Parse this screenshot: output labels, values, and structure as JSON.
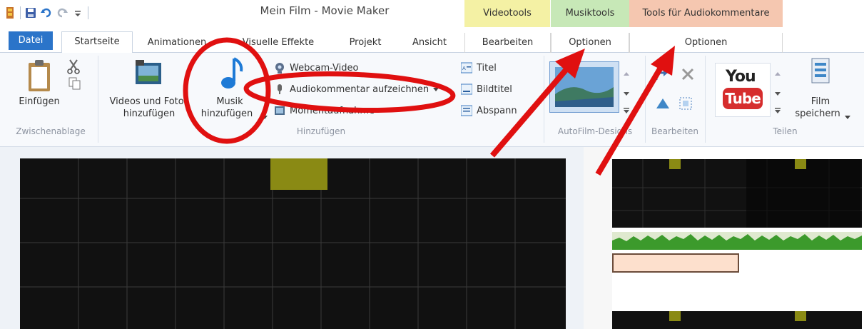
{
  "window": {
    "title": "Mein Film - Movie Maker"
  },
  "contextual_tabs": {
    "video": "Videotools",
    "musik": "Musiktools",
    "audio": "Tools für Audiokommentare"
  },
  "tabs": [
    {
      "label": "Datei"
    },
    {
      "label": "Startseite"
    },
    {
      "label": "Animationen"
    },
    {
      "label": "Visuelle Effekte"
    },
    {
      "label": "Projekt"
    },
    {
      "label": "Ansicht"
    },
    {
      "label": "Bearbeiten"
    },
    {
      "label": "Optionen"
    },
    {
      "label": "Optionen"
    }
  ],
  "ribbon": {
    "clipboard": {
      "paste_label": "Einfügen",
      "group_label": "Zwischenablage"
    },
    "add": {
      "videos_line1": "Videos und Fotos",
      "videos_line2": "hinzufügen",
      "music_line1": "Musik",
      "music_line2": "hinzufügen",
      "webcam": "Webcam-Video",
      "narration": "Audiokommentar aufzeichnen",
      "snapshot": "Momentaufnahme",
      "title": "Titel",
      "caption": "Bildtitel",
      "credits": "Abspann",
      "group_label": "Hinzufügen"
    },
    "themes": {
      "group_label": "AutoFilm-Designs"
    },
    "edit": {
      "group_label": "Bearbeiten"
    },
    "share": {
      "youtube_top": "You",
      "youtube_bottom": "Tube",
      "save_line1": "Film",
      "save_line2": "speichern",
      "group_label": "Teilen"
    }
  },
  "colors": {
    "annotation_red": "#e01010",
    "file_tab": "#2b74c9",
    "video_tools": "#f4f1a4",
    "music_tools": "#c7e8b7",
    "audio_tools": "#f5c7b0"
  }
}
